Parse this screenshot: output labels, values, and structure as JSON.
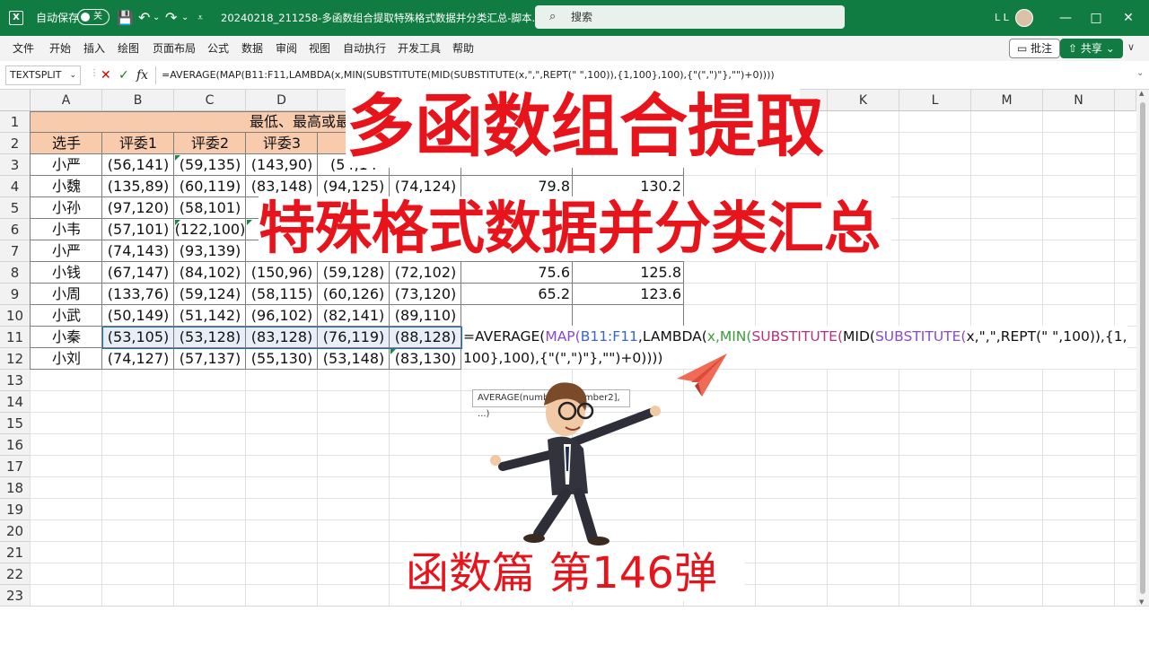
{
  "titlebar": {
    "logo": "X",
    "autosave_label": "自动保存",
    "autosave_state": "关",
    "doc_title": "20240218_211258-多函数组合提取特殊格式数据并分类汇总-脚本.x...",
    "search_placeholder": "搜索",
    "user_initials": "L L",
    "save_icon": "💾",
    "undo_icon": "↶",
    "redo_icon": "↷",
    "dropdown_arrow": "⌄",
    "customize_icon": "⩡",
    "minimize": "—",
    "maximize": "□",
    "close": "✕"
  },
  "menu": {
    "items": [
      "文件",
      "开始",
      "插入",
      "绘图",
      "页面布局",
      "公式",
      "数据",
      "审阅",
      "视图",
      "自动执行",
      "开发工具",
      "帮助"
    ],
    "comment_btn": "批注",
    "share_btn": "共享",
    "collapse": "∨"
  },
  "formula_bar": {
    "name_box": "TEXTSPLIT",
    "cancel": "✕",
    "confirm": "✓",
    "fx": "fx",
    "formula": "=AVERAGE(MAP(B11:F11,LAMBDA(x,MIN(SUBSTITUTE(MID(SUBSTITUTE(x,\",\",REPT(\" \",100)),{1,100},100),{\"(\",\")\"},\"\")+0))))"
  },
  "columns": [
    "A",
    "B",
    "C",
    "D",
    "E",
    "F",
    "G",
    "H",
    "I",
    "J",
    "K",
    "L",
    "M",
    "N"
  ],
  "rows": [
    "1",
    "2",
    "3",
    "4",
    "5",
    "6",
    "7",
    "8",
    "9",
    "10",
    "11",
    "12",
    "13",
    "14",
    "15",
    "16",
    "17",
    "18",
    "19",
    "20",
    "21",
    "22",
    "23"
  ],
  "sheet": {
    "title_partial": "最低、最高或最",
    "headers": [
      "选手",
      "评委1",
      "评委2",
      "评委3",
      "评"
    ],
    "names": [
      "小严",
      "小魏",
      "小孙",
      "小韦",
      "小严",
      "小钱",
      "小周",
      "小武",
      "小秦",
      "小刘"
    ],
    "b": [
      "(56,141)",
      "(135,89)",
      "(97,120)",
      "(57,101)",
      "(74,143)",
      "(67,147)",
      "(133,76)",
      "(50,149)",
      "(53,105)",
      "(74,127)"
    ],
    "c": [
      "(59,135)",
      "(60,119)",
      "(58,101)",
      "(122,100)",
      "(93,139)",
      "(84,102)",
      "(59,124)",
      "(51,142)",
      "(53,128)",
      "(57,137)"
    ],
    "d": [
      "(143,90)",
      "(83,148)",
      "(",
      "(",
      "(",
      "(150,96)",
      "(58,115)",
      "(96,102)",
      "(83,128)",
      "(55,130)"
    ],
    "e": [
      "(54,14",
      "(94,125)",
      "",
      "",
      "",
      "(59,128)",
      "(60,126)",
      "(82,141)",
      "(76,119)",
      "(53,148)"
    ],
    "f": [
      "",
      "(74,124)",
      "",
      "",
      "",
      "(72,102)",
      "(73,120)",
      "(89,110)",
      "(88,128)",
      "(83,130)"
    ],
    "g_row3": "",
    "g_row4": "79.8",
    "h_row4": "130.2",
    "g_row8": "75.6",
    "h_row8": "125.8",
    "g_row9": "65.2",
    "h_row9": "123.6"
  },
  "in_cell_formula": {
    "part1": "=AVERAGE(",
    "part2": "MAP(",
    "ref": "B11:F11",
    "part3": ",LAMBDA(",
    "part4": "x,MIN(",
    "part5": "SUBSTITUTE(",
    "part6": "MID(",
    "part7": "SUBSTITUTE(",
    "part8": "x,\",\",REPT(\" \",100)",
    "part9": "),{1,",
    "line2": "100},100),{\"(\",\")\"},\"\")+0))))"
  },
  "tooltip": "AVERAGE(number1, [number2], ...)",
  "overlay": {
    "title1": "多函数组合提取",
    "title2": "特殊格式数据并分类汇总",
    "footer": "函数篇 第146弹"
  },
  "colors": {
    "excel_green": "#107c41",
    "header_orange": "#f8cbad",
    "title_red": "#e8141b"
  }
}
